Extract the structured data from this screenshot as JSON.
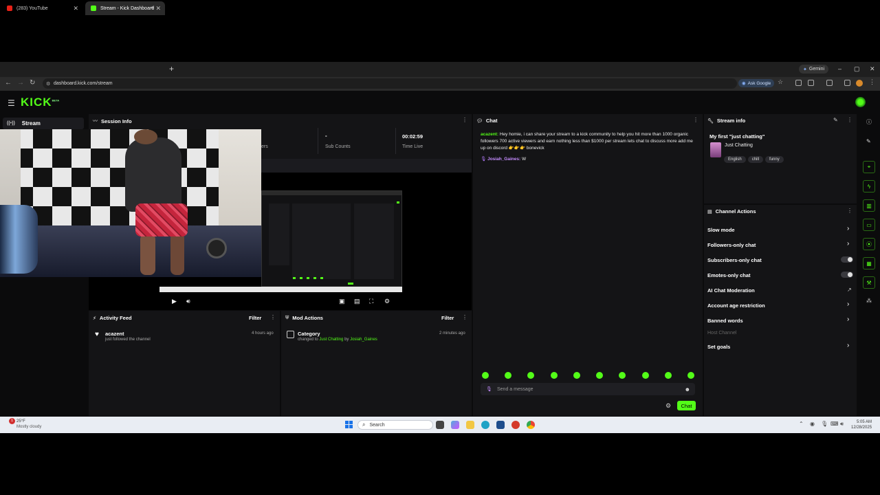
{
  "browser": {
    "tabs": [
      {
        "title": "(283) YouTube"
      },
      {
        "title": "Stream - Kick Dashboard"
      }
    ],
    "url": "dashboard.kick.com/stream",
    "gemini": "Gemini",
    "ask_google": "Ask Google"
  },
  "app": {
    "logo": "KICK",
    "logo_sup": "BETA",
    "sidebar": {
      "stream_label": "Stream"
    }
  },
  "session": {
    "title": "Session Info",
    "stats": [
      {
        "value": "-",
        "label": "Sub Counts"
      },
      {
        "value": "00:02:59",
        "label": "Time Live"
      }
    ],
    "partial_label": "ers"
  },
  "activity": {
    "title": "Activity Feed",
    "filter": "Filter",
    "items": [
      {
        "user": "acazent",
        "text": "just followed the channel",
        "time": "4 hours ago"
      }
    ]
  },
  "mod_actions": {
    "title": "Mod Actions",
    "filter": "Filter",
    "items": [
      {
        "title": "Category",
        "prefix": "changed to",
        "category": "Just Chatting",
        "by": "by",
        "user": "Josiah_Gaines",
        "time": "2 minutes ago"
      }
    ]
  },
  "chat": {
    "title": "Chat",
    "messages": [
      {
        "user": "acazent:",
        "text": "Hey homie, i can share your stream to a kick community to help you hit more than 1000 organic followers 700 active viewers and earn nothing less than $1000 per stream lets chat to discuss more add me up on discord 👉👉👉 bonevick"
      },
      {
        "user": "Josiah_Gaines:",
        "text": "W"
      }
    ],
    "input_placeholder": "Send a message",
    "send_label": "Chat"
  },
  "stream_info": {
    "title": "Stream info",
    "stream_title": "My first \"just chatting\"",
    "category": "Just Chatting",
    "tags": [
      "English",
      "chill",
      "funny"
    ]
  },
  "channel_actions": {
    "title": "Channel Actions",
    "items": [
      {
        "label": "Slow mode",
        "control": "chevron"
      },
      {
        "label": "Followers-only chat",
        "control": "chevron"
      },
      {
        "label": "Subscribers-only chat",
        "control": "toggle"
      },
      {
        "label": "Emotes-only chat",
        "control": "toggle"
      },
      {
        "label": "AI Chat Moderation",
        "control": "external"
      },
      {
        "label": "Account age restriction",
        "control": "chevron"
      },
      {
        "label": "Banned words",
        "control": "chevron"
      },
      {
        "label": "Host Channel",
        "control": "disabled"
      },
      {
        "label": "Set goals",
        "control": "chevron"
      }
    ]
  },
  "taskbar": {
    "weather_temp": "25°F",
    "weather_desc": "Mostly cloudy",
    "search": "Search",
    "time": "5:05 AM",
    "date": "12/28/2025",
    "notification_count": "1"
  },
  "colors": {
    "accent": "#53fc18",
    "panel": "#141416",
    "background": "#0b0b0c"
  }
}
